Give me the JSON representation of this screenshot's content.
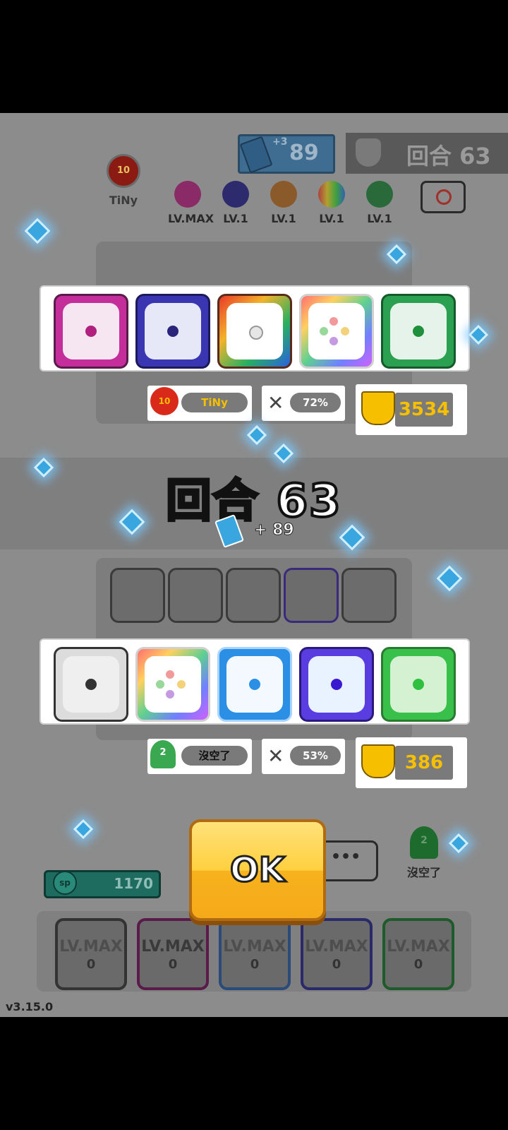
{
  "top": {
    "cards_count": "89",
    "cards_plus": "+3",
    "round_label": "回合 63"
  },
  "player_top": {
    "name": "TiNy",
    "rank": "10"
  },
  "enemy_dice": [
    {
      "label": "LV.MAX",
      "color": "#c0308f"
    },
    {
      "label": "LV.1",
      "color": "#3d35a0"
    },
    {
      "label": "LV.1",
      "color": "#e38a2a"
    },
    {
      "label": "LV.1",
      "color": "#e0b030"
    },
    {
      "label": "LV.1",
      "color": "#2fae4a"
    }
  ],
  "result_top": {
    "dice": [
      {
        "name": "magenta-dice",
        "color": "#c42e9a"
      },
      {
        "name": "time-dice",
        "color": "#3a35b0"
      },
      {
        "name": "infinity-dice",
        "color": "#e85b2a"
      },
      {
        "name": "rainbow-dice",
        "color": "#e8e0f0"
      },
      {
        "name": "pentagram-dice",
        "color": "#2aa050"
      }
    ],
    "player_name": "TiNy",
    "player_rank": "10",
    "win_rate": "72%",
    "trophies": "3534"
  },
  "round_banner": {
    "title": "回合 63",
    "cards_gain": "+ 89"
  },
  "result_bottom": {
    "dice": [
      {
        "name": "gear-dice",
        "color": "#555555"
      },
      {
        "name": "rainbow-dice",
        "color": "#e8e0f0"
      },
      {
        "name": "ice-dice",
        "color": "#2b8fe6"
      },
      {
        "name": "blessing-dice",
        "color": "#5a3de0"
      },
      {
        "name": "biohazard-dice",
        "color": "#38c04a"
      }
    ],
    "player_name": "沒空了",
    "player_rank": "2",
    "win_rate": "53%",
    "trophies": "386"
  },
  "bottom": {
    "sp_value": "1170",
    "sp_label": "sp",
    "self_name": "沒空了",
    "self_rank": "2",
    "ok_label": "OK",
    "chat_dots": "•••",
    "deck": [
      {
        "label": "LV.MAX",
        "sp": "0"
      },
      {
        "label": "LV.MAX",
        "sp": "0"
      },
      {
        "label": "LV.MAX",
        "sp": "0"
      },
      {
        "label": "LV.MAX",
        "sp": "0"
      },
      {
        "label": "LV.MAX",
        "sp": "0"
      }
    ],
    "version": "v3.15.0"
  },
  "colors": {
    "gold": "#f6c000",
    "blue_gem": "#3aa6e0"
  }
}
